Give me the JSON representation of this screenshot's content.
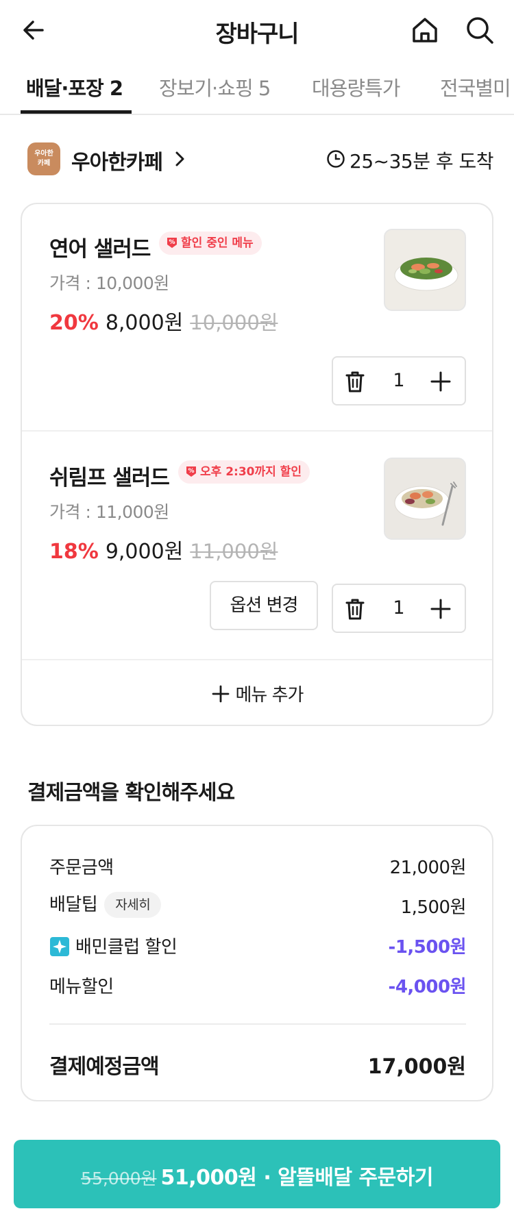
{
  "header": {
    "title": "장바구니"
  },
  "tabs": [
    {
      "label": "배달·포장 2",
      "active": true
    },
    {
      "label": "장보기·쇼핑 5",
      "active": false
    },
    {
      "label": "대용량특가",
      "active": false
    },
    {
      "label": "전국별미",
      "active": false
    }
  ],
  "store": {
    "logo_text": "우아한\n카페",
    "name": "우아한카페",
    "eta": "25~35분 후 도착"
  },
  "items": [
    {
      "name": "연어 샐러드",
      "badge": "할인 중인 메뉴",
      "price_label": "가격 : 10,000원",
      "discount_rate": "20%",
      "sale_price": "8,000원",
      "original_price": "10,000원",
      "quantity": "1"
    },
    {
      "name": "쉬림프 샐러드",
      "badge": "오후 2:30까지 할인",
      "price_label": "가격 : 11,000원",
      "discount_rate": "18%",
      "sale_price": "9,000원",
      "original_price": "11,000원",
      "quantity": "1",
      "option_button": "옵션 변경"
    }
  ],
  "add_menu_label": "메뉴 추가",
  "payment": {
    "heading": "결제금액을 확인해주세요",
    "rows": [
      {
        "label": "주문금액",
        "value": "21,000원"
      },
      {
        "label": "배달팁",
        "chip": "자세히",
        "value": "1,500원"
      },
      {
        "label": "배민클럽 할인",
        "value": "-1,500원"
      },
      {
        "label": "메뉴할인",
        "value": "-4,000원"
      }
    ],
    "total_label": "결제예정금액",
    "total_value": "17,000원"
  },
  "order_button": {
    "original": "55,000원",
    "label": "51,000원 · 알뜰배달 주문하기"
  },
  "colors": {
    "accent": "#2cc1b8",
    "discount_red": "#f0383f",
    "discount_purple": "#6a52f0",
    "badge_bg": "#fdecee"
  },
  "icons": [
    "back-arrow-icon",
    "home-icon",
    "search-icon",
    "chevron-right-icon",
    "clock-icon",
    "discount-tag-icon",
    "trash-icon",
    "plus-icon",
    "baemin-club-icon"
  ]
}
